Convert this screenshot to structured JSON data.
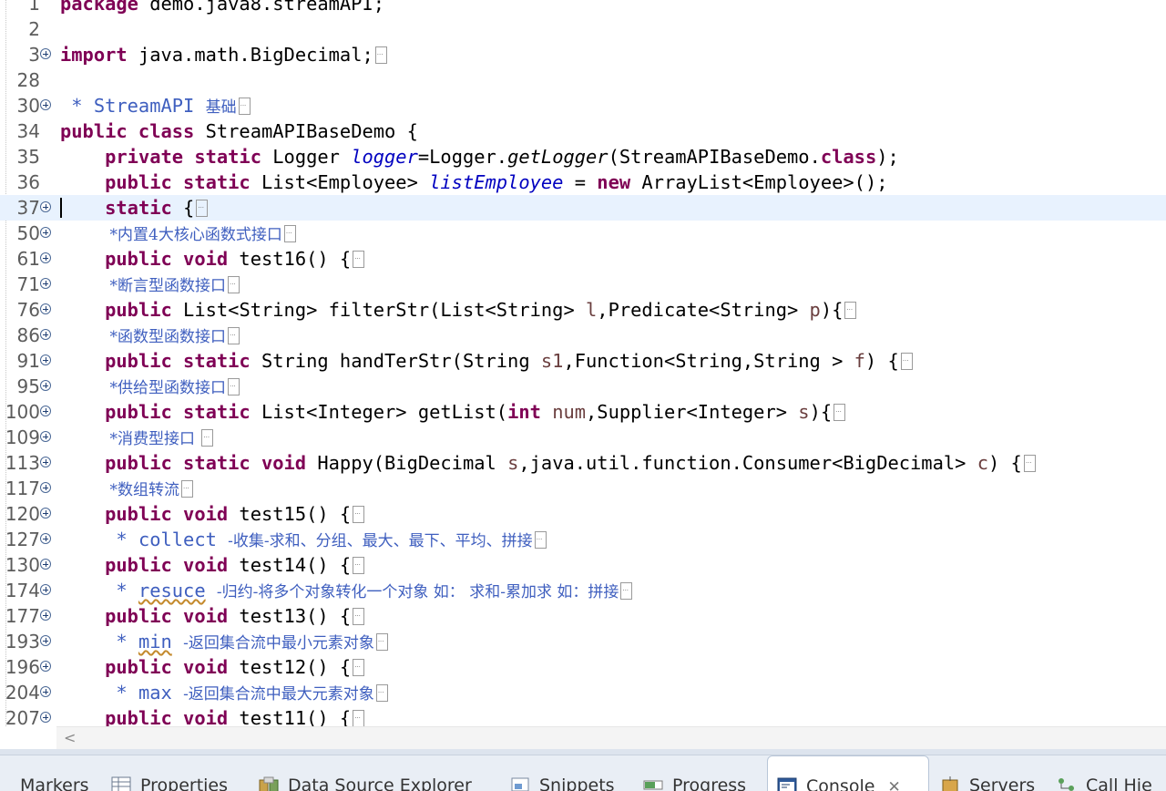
{
  "editor": {
    "lines": [
      {
        "num": "1",
        "fold": false,
        "parts": [
          [
            "kw",
            "package"
          ],
          [
            "t",
            " demo.java8.streamAPI;"
          ]
        ]
      },
      {
        "num": "2",
        "fold": false,
        "parts": []
      },
      {
        "num": "3",
        "fold": true,
        "parts": [
          [
            "kw",
            "import"
          ],
          [
            "t",
            " java.math.BigDecimal;"
          ],
          [
            "ell",
            ""
          ]
        ]
      },
      {
        "num": "28",
        "fold": false,
        "parts": []
      },
      {
        "num": "30",
        "fold": true,
        "parts": [
          [
            "doc",
            " * StreamAPI "
          ],
          [
            "doc cjk",
            "基础"
          ],
          [
            "ell",
            ""
          ]
        ]
      },
      {
        "num": "34",
        "fold": false,
        "parts": [
          [
            "kw",
            "public class"
          ],
          [
            "t",
            " StreamAPIBaseDemo {"
          ]
        ]
      },
      {
        "num": "35",
        "fold": false,
        "parts": [
          [
            "t",
            "    "
          ],
          [
            "kw",
            "private static"
          ],
          [
            "t",
            " Logger "
          ],
          [
            "fld",
            "logger"
          ],
          [
            "t",
            "=Logger."
          ],
          [
            "mth",
            "getLogger"
          ],
          [
            "t",
            "(StreamAPIBaseDemo."
          ],
          [
            "kw",
            "class"
          ],
          [
            "t",
            ");"
          ]
        ]
      },
      {
        "num": "36",
        "fold": false,
        "parts": [
          [
            "t",
            "    "
          ],
          [
            "kw",
            "public static"
          ],
          [
            "t",
            " List<Employee> "
          ],
          [
            "fld",
            "listEmployee"
          ],
          [
            "t",
            " = "
          ],
          [
            "kw",
            "new"
          ],
          [
            "t",
            " ArrayList<Employee>();"
          ]
        ]
      },
      {
        "num": "37",
        "fold": true,
        "current": true,
        "parts": [
          [
            "t",
            "    "
          ],
          [
            "kw",
            "static"
          ],
          [
            "t",
            " {"
          ],
          [
            "ell",
            ""
          ]
        ]
      },
      {
        "num": "50",
        "fold": true,
        "parts": [
          [
            "t",
            "    "
          ],
          [
            "doc cjk",
            " *内置"
          ],
          [
            "doc cjk",
            "4"
          ],
          [
            "doc cjk",
            "大核心函数式接口"
          ],
          [
            "ell",
            ""
          ]
        ]
      },
      {
        "num": "61",
        "fold": true,
        "parts": [
          [
            "t",
            "    "
          ],
          [
            "kw",
            "public void"
          ],
          [
            "t",
            " test16() {"
          ],
          [
            "ell",
            ""
          ]
        ]
      },
      {
        "num": "71",
        "fold": true,
        "parts": [
          [
            "t",
            "    "
          ],
          [
            "doc cjk",
            " *断言型函数接口"
          ],
          [
            "ell",
            ""
          ]
        ]
      },
      {
        "num": "76",
        "fold": true,
        "parts": [
          [
            "t",
            "    "
          ],
          [
            "kw",
            "public"
          ],
          [
            "t",
            " List<String> filterStr(List<String> "
          ],
          [
            "prm",
            "l"
          ],
          [
            "t",
            ",Predicate<String> "
          ],
          [
            "prm",
            "p"
          ],
          [
            "t",
            "){"
          ],
          [
            "ell",
            ""
          ]
        ]
      },
      {
        "num": "86",
        "fold": true,
        "parts": [
          [
            "t",
            "    "
          ],
          [
            "doc cjk",
            " *函数型函数接口"
          ],
          [
            "ell",
            ""
          ]
        ]
      },
      {
        "num": "91",
        "fold": true,
        "parts": [
          [
            "t",
            "    "
          ],
          [
            "kw",
            "public static"
          ],
          [
            "t",
            " String handTerStr(String "
          ],
          [
            "prm",
            "s1"
          ],
          [
            "t",
            ",Function<String,String > "
          ],
          [
            "prm",
            "f"
          ],
          [
            "t",
            ") {"
          ],
          [
            "ell",
            ""
          ]
        ]
      },
      {
        "num": "95",
        "fold": true,
        "parts": [
          [
            "t",
            "    "
          ],
          [
            "doc cjk",
            " *供给型函数接口"
          ],
          [
            "ell",
            ""
          ]
        ]
      },
      {
        "num": "100",
        "fold": true,
        "parts": [
          [
            "t",
            "    "
          ],
          [
            "kw",
            "public static"
          ],
          [
            "t",
            " List<Integer> getList("
          ],
          [
            "kw",
            "int"
          ],
          [
            "t",
            " "
          ],
          [
            "prm",
            "num"
          ],
          [
            "t",
            ",Supplier<Integer> "
          ],
          [
            "prm",
            "s"
          ],
          [
            "t",
            "){"
          ],
          [
            "ell",
            ""
          ]
        ]
      },
      {
        "num": "109",
        "fold": true,
        "parts": [
          [
            "t",
            "    "
          ],
          [
            "doc cjk",
            " *消费型接口 "
          ],
          [
            "ell",
            ""
          ]
        ]
      },
      {
        "num": "113",
        "fold": true,
        "parts": [
          [
            "t",
            "    "
          ],
          [
            "kw",
            "public static void"
          ],
          [
            "t",
            " Happy(BigDecimal "
          ],
          [
            "prm",
            "s"
          ],
          [
            "t",
            ",java.util.function.Consumer<BigDecimal> "
          ],
          [
            "prm",
            "c"
          ],
          [
            "t",
            ") {"
          ],
          [
            "ell",
            ""
          ]
        ]
      },
      {
        "num": "117",
        "fold": true,
        "parts": [
          [
            "t",
            "    "
          ],
          [
            "doc cjk",
            " *数组转流"
          ],
          [
            "ell",
            ""
          ]
        ]
      },
      {
        "num": "120",
        "fold": true,
        "parts": [
          [
            "t",
            "    "
          ],
          [
            "kw",
            "public void"
          ],
          [
            "t",
            " test15() {"
          ],
          [
            "ell",
            ""
          ]
        ]
      },
      {
        "num": "127",
        "fold": true,
        "parts": [
          [
            "t",
            "     "
          ],
          [
            "doc",
            "* collect "
          ],
          [
            "doc cjk",
            "-收集-求和、分组、最大、最下、平均、拼接"
          ],
          [
            "ell",
            ""
          ]
        ]
      },
      {
        "num": "130",
        "fold": true,
        "parts": [
          [
            "t",
            "    "
          ],
          [
            "kw",
            "public void"
          ],
          [
            "t",
            " test14() {"
          ],
          [
            "ell",
            ""
          ]
        ]
      },
      {
        "num": "174",
        "fold": true,
        "parts": [
          [
            "t",
            "     "
          ],
          [
            "doc",
            "* "
          ],
          [
            "doc sq",
            "resuce"
          ],
          [
            "doc",
            " "
          ],
          [
            "doc cjk",
            "-归约-将多个对象转化一个对象 如： 求和-累加求 如：拼接"
          ],
          [
            "ell",
            ""
          ]
        ]
      },
      {
        "num": "177",
        "fold": true,
        "parts": [
          [
            "t",
            "    "
          ],
          [
            "kw",
            "public void"
          ],
          [
            "t",
            " test13() {"
          ],
          [
            "ell",
            ""
          ]
        ]
      },
      {
        "num": "193",
        "fold": true,
        "parts": [
          [
            "t",
            "     "
          ],
          [
            "doc",
            "* "
          ],
          [
            "doc sq",
            "min"
          ],
          [
            "doc",
            " "
          ],
          [
            "doc cjk",
            "-返回集合流中最小元素对象"
          ],
          [
            "ell",
            ""
          ]
        ]
      },
      {
        "num": "196",
        "fold": true,
        "parts": [
          [
            "t",
            "    "
          ],
          [
            "kw",
            "public void"
          ],
          [
            "t",
            " test12() {"
          ],
          [
            "ell",
            ""
          ]
        ]
      },
      {
        "num": "204",
        "fold": true,
        "parts": [
          [
            "t",
            "     "
          ],
          [
            "doc",
            "* max "
          ],
          [
            "doc cjk",
            "-返回集合流中最大元素对象"
          ],
          [
            "ell",
            ""
          ]
        ]
      },
      {
        "num": "207",
        "fold": true,
        "parts": [
          [
            "t",
            "    "
          ],
          [
            "kw",
            "public void"
          ],
          [
            "t",
            " test11() {"
          ],
          [
            "ell",
            ""
          ]
        ]
      }
    ]
  },
  "scrollbar": {
    "left_arrow": "<"
  },
  "views": [
    {
      "label": "Markers",
      "icon": "markers-icon",
      "active": false
    },
    {
      "label": "Properties",
      "icon": "properties-icon",
      "active": false
    },
    {
      "label": "Data Source Explorer",
      "icon": "data-source-explorer-icon",
      "active": false
    },
    {
      "label": "Snippets",
      "icon": "snippets-icon",
      "active": false
    },
    {
      "label": "Progress",
      "icon": "progress-icon",
      "active": false
    },
    {
      "label": "Console",
      "icon": "console-icon",
      "active": true,
      "close": "✕"
    },
    {
      "label": "Servers",
      "icon": "servers-icon",
      "active": false
    },
    {
      "label": "Call Hie",
      "icon": "call-hierarchy-icon",
      "active": false
    }
  ],
  "colors": {
    "keyword": "#7f0055",
    "field": "#0000c0",
    "javadoc": "#3f5fbf",
    "param": "#6a3e3e",
    "current_line": "#e8f2fe"
  }
}
